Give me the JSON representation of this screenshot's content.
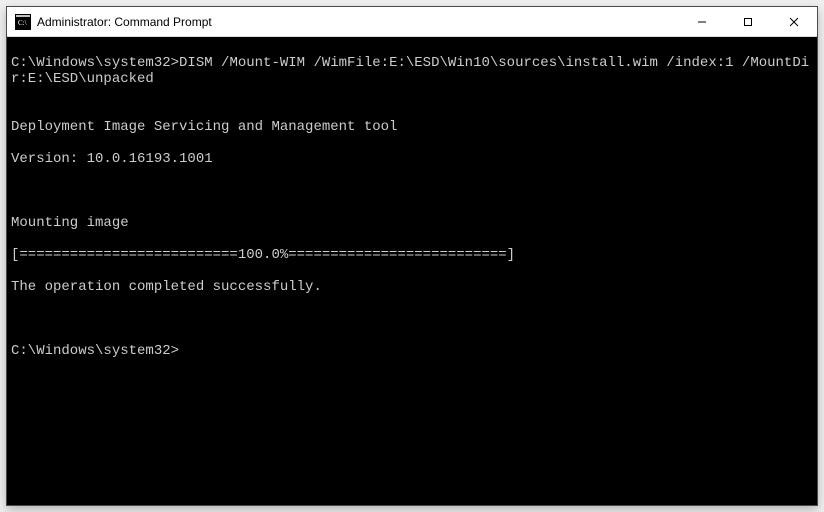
{
  "window": {
    "title": "Administrator: Command Prompt",
    "icon_name": "cmd-icon"
  },
  "controls": {
    "minimize": "—",
    "maximize": "☐",
    "close": "✕"
  },
  "console": {
    "prompt1": "C:\\Windows\\system32>",
    "command1": "DISM /Mount-WIM /WimFile:E:\\ESD\\Win10\\sources\\install.wim /index:1 /MountDir:E:\\ESD\\unpacked",
    "blank1": " ",
    "tool_line1": "Deployment Image Servicing and Management tool",
    "tool_line2": "Version: 10.0.16193.1001",
    "blank2": " ",
    "mounting": "Mounting image",
    "progress": "[==========================100.0%==========================]",
    "success": "The operation completed successfully.",
    "blank3": " ",
    "prompt2": "C:\\Windows\\system32>"
  }
}
